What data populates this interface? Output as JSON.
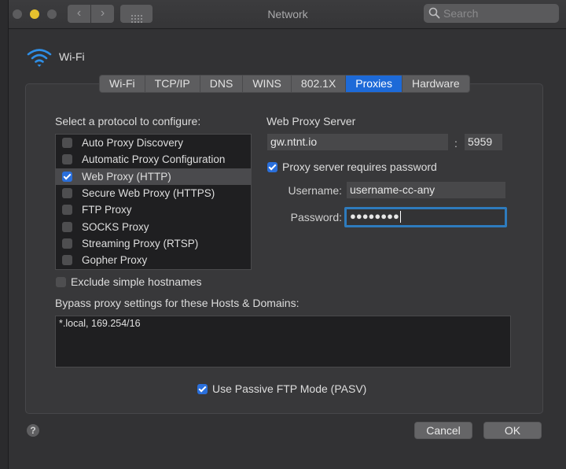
{
  "window": {
    "title": "Network",
    "search_placeholder": "Search",
    "traffic_lights": [
      "close",
      "minimize",
      "maximize"
    ],
    "nav": {
      "back": "‹",
      "forward": "›"
    }
  },
  "header": {
    "service_name": "Wi-Fi",
    "icon": "wifi-icon",
    "accent": "#2f8ee5"
  },
  "tabs": [
    {
      "label": "Wi-Fi",
      "active": false
    },
    {
      "label": "TCP/IP",
      "active": false
    },
    {
      "label": "DNS",
      "active": false
    },
    {
      "label": "WINS",
      "active": false
    },
    {
      "label": "802.1X",
      "active": false
    },
    {
      "label": "Proxies",
      "active": true
    },
    {
      "label": "Hardware",
      "active": false
    }
  ],
  "protocols": {
    "label": "Select a protocol to configure:",
    "items": [
      {
        "label": "Auto Proxy Discovery",
        "checked": false,
        "selected": false
      },
      {
        "label": "Automatic Proxy Configuration",
        "checked": false,
        "selected": false
      },
      {
        "label": "Web Proxy (HTTP)",
        "checked": true,
        "selected": true
      },
      {
        "label": "Secure Web Proxy (HTTPS)",
        "checked": false,
        "selected": false
      },
      {
        "label": "FTP Proxy",
        "checked": false,
        "selected": false
      },
      {
        "label": "SOCKS Proxy",
        "checked": false,
        "selected": false
      },
      {
        "label": "Streaming Proxy (RTSP)",
        "checked": false,
        "selected": false
      },
      {
        "label": "Gopher Proxy",
        "checked": false,
        "selected": false
      }
    ]
  },
  "server": {
    "heading": "Web Proxy Server",
    "host": "gw.ntnt.io",
    "colon": ":",
    "port": "5959",
    "requires_password_label": "Proxy server requires password",
    "requires_password": true,
    "username_label": "Username:",
    "username": "username-cc-any",
    "password_label": "Password:",
    "password_masked": "●●●●●●●●"
  },
  "exclude_simple": {
    "label": "Exclude simple hostnames",
    "checked": false
  },
  "bypass": {
    "label": "Bypass proxy settings for these Hosts & Domains:",
    "value": "*.local, 169.254/16"
  },
  "passive_ftp": {
    "label": "Use Passive FTP Mode (PASV)",
    "checked": true
  },
  "footer": {
    "help": "?",
    "cancel": "Cancel",
    "ok": "OK"
  },
  "colors": {
    "accent_blue": "#1d6ad8",
    "focus_ring": "#2e7bbd",
    "minimize_yellow": "#e6c12e"
  }
}
